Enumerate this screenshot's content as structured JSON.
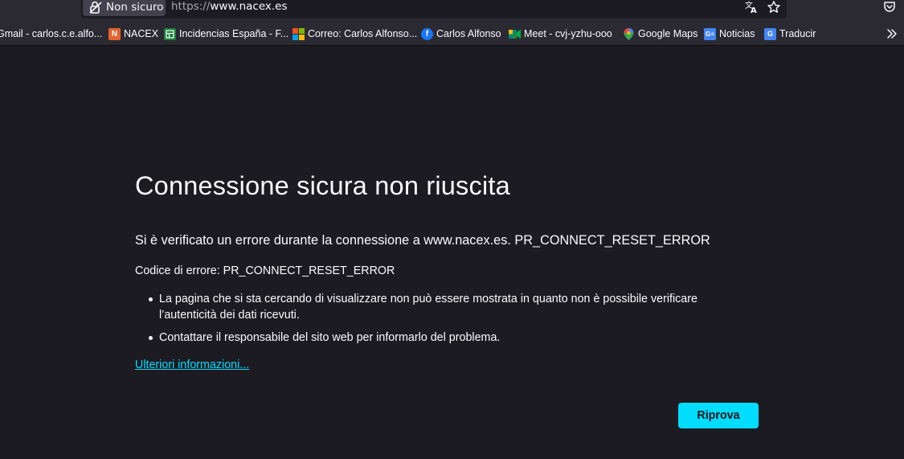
{
  "urlbar": {
    "identity_label": "Non sicuro",
    "url_scheme": "https://",
    "url_host": "www.nacex.es"
  },
  "bookmarks": [
    {
      "label": "Gmail - carlos.c.e.alfo...",
      "icon": "gmail-icon",
      "color": "#ea4335"
    },
    {
      "label": "NACEX",
      "icon": "nacex-icon",
      "color": "#e3632b"
    },
    {
      "label": "Incidencias España - F...",
      "icon": "sheets-icon",
      "color": "#188038"
    },
    {
      "label": "Correo: Carlos Alfonso...",
      "icon": "microsoft-icon",
      "color": "#f25022"
    },
    {
      "label": "Carlos Alfonso",
      "icon": "facebook-icon",
      "color": "#1877f2"
    },
    {
      "label": "Meet - cvj-yzhu-ooo",
      "icon": "meet-icon",
      "color": "#00897b"
    },
    {
      "label": "Google Maps",
      "icon": "maps-icon",
      "color": "#34a853"
    },
    {
      "label": "Noticias",
      "icon": "news-icon",
      "color": "#4285f4"
    },
    {
      "label": "Traducir",
      "icon": "translate-icon",
      "color": "#4285f4"
    }
  ],
  "error_page": {
    "title": "Connessione sicura non riuscita",
    "summary": "Si è verificato un errore durante la connessione a www.nacex.es. PR_CONNECT_RESET_ERROR",
    "error_code": "Codice di errore: PR_CONNECT_RESET_ERROR",
    "reasons": [
      "La pagina che si sta cercando di visualizzare non può essere mostrata in quanto non è possibile verificare l’autenticità dei dati ricevuti.",
      "Contattare il responsabile del sito web per informarlo del problema."
    ],
    "learn_more": "Ulteriori informazioni...",
    "retry_button": "Riprova"
  },
  "colors": {
    "page_background": "#1c1b22",
    "toolbar_background": "#2b2a33",
    "accent": "#00ddff",
    "text": "#fbfbfe"
  }
}
